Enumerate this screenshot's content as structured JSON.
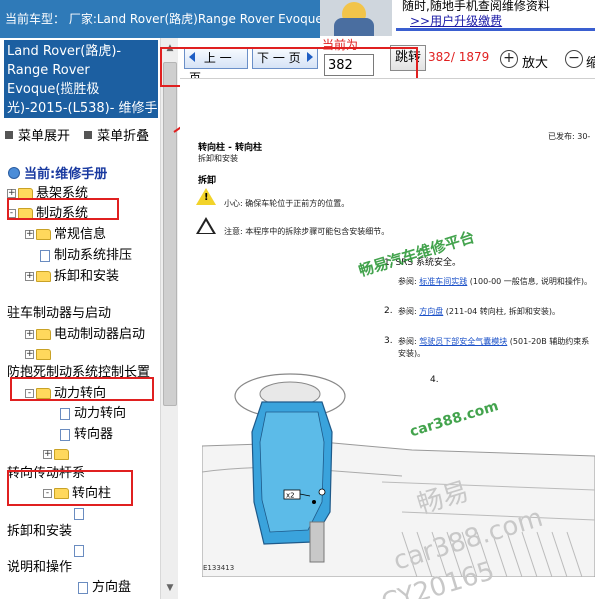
{
  "header": {
    "car_type": "当前车型： 厂家:Land Rover(路虎)Range Rover Evoque(揽胜极光)2015-(L538)",
    "ad_line1": "随时,随地手机查阅维修资料",
    "ad_line2": ">>用户升级缴费"
  },
  "sidebar": {
    "manual_title": "Land Rover(路虎)-Range Rover Evoque(揽胜极光)-2015-(L538)- 维修手册.",
    "menu_expand": "菜单展开",
    "menu_collapse": "菜单折叠",
    "tree_title": "当前:维修手册",
    "tree": [
      {
        "label": "悬架系统",
        "type": "folder",
        "expander": "+"
      },
      {
        "label": "制动系统",
        "type": "folder",
        "expander": "-"
      },
      {
        "label": "常规信息",
        "type": "folder",
        "expander": "+"
      },
      {
        "label": "制动系统排压",
        "type": "page",
        "expander": ""
      },
      {
        "label": "拆卸和安装",
        "type": "folder",
        "expander": "+"
      },
      {
        "label": "驻车制动器与启动",
        "type": "text",
        "expander": ""
      },
      {
        "label": "电动制动器启动",
        "type": "folder",
        "expander": "+"
      },
      {
        "label": "",
        "type": "folder",
        "expander": "+"
      },
      {
        "label": "防抱死制动系统控制长置",
        "type": "text",
        "expander": ""
      },
      {
        "label": "动力转向",
        "type": "folder",
        "expander": "-"
      },
      {
        "label": "动力转向",
        "type": "page",
        "expander": ""
      },
      {
        "label": "转向器",
        "type": "page",
        "expander": ""
      },
      {
        "label": "",
        "type": "folder",
        "expander": "+"
      },
      {
        "label": "转向传动杆系",
        "type": "text",
        "expander": ""
      },
      {
        "label": "转向柱",
        "type": "folder",
        "expander": "-"
      },
      {
        "label": "",
        "type": "page",
        "expander": ""
      },
      {
        "label": "拆卸和安装",
        "type": "text",
        "expander": ""
      },
      {
        "label": "",
        "type": "page",
        "expander": ""
      },
      {
        "label": "说明和操作",
        "type": "text",
        "expander": ""
      },
      {
        "label": "方向盘",
        "type": "page",
        "expander": ""
      }
    ]
  },
  "toolbar": {
    "current_label": "当前为",
    "prev_label": "上 一 页",
    "next_label": "下 一 页",
    "page_value": "382",
    "jump_label": "跳转",
    "page_count": "382/ 1879",
    "zoom_in_label": "放大",
    "zoom_out_label": "缩"
  },
  "document": {
    "published": "已发布: 30-",
    "title": "转向柱 - 转向柱",
    "subtitle": "拆卸和安装",
    "section": "拆卸",
    "warning_label": "小心:",
    "warning_text": "确保车轮位于正前方的位置。",
    "note_label": "注意:",
    "note_text": "本程序中的拆除步骤可能包含安装细节。",
    "step1_prefix": "1.",
    "step1_text": "SRS 系统安全。",
    "step1_ref_label": "参阅:",
    "step1_ref_link": "标准车间实践",
    "step1_ref_rest": "(100-00 一般信息, 说明和操作)。",
    "step2_prefix": "2.",
    "step2_ref_label": "参阅:",
    "step2_ref_link": "方向盘",
    "step2_ref_rest": "(211-04 转向柱, 拆卸和安装)。",
    "step3_prefix": "3.",
    "step3_ref_label": "参阅:",
    "step3_ref_link": "驾驶员下部安全气囊模块",
    "step3_ref_rest": "(501-20B 辅助约束系",
    "step3_ref_cont": "安装)。",
    "step4_prefix": "4.",
    "figure_id": "E133413",
    "callout": "x2"
  },
  "watermarks": {
    "brand": "畅易汽车维修平台",
    "site": "car388.com",
    "brand_short": "畅易",
    "site2": "car388.com",
    "code": "CY20165"
  },
  "colors": {
    "header_blue": "#2f7ab8",
    "title_blue": "#1c5fa1",
    "annotation_red": "#e02020",
    "watermark_green": "#2f9a3a"
  }
}
